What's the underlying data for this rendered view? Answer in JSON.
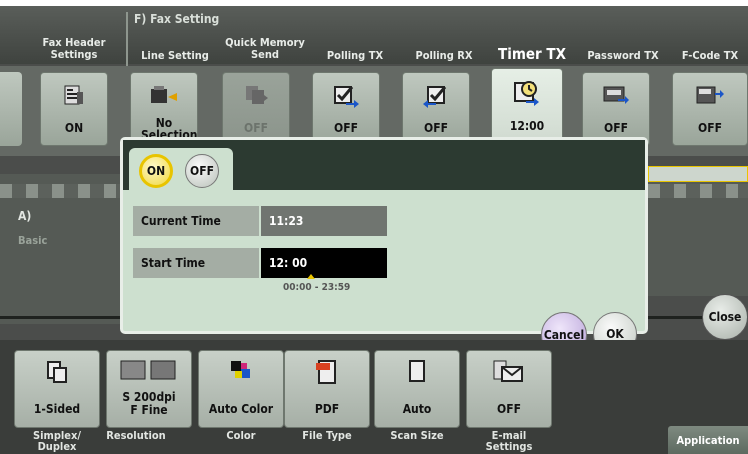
{
  "section_title": "F)  Fax Setting",
  "top_tabs": [
    {
      "label": "Fax Header Settings",
      "value": "ON",
      "icon": "fax-header-icon"
    },
    {
      "label": "Line Setting",
      "value": "No Selection",
      "icon": "line-setting-icon"
    },
    {
      "label": "Quick Memory Send",
      "value": "OFF",
      "icon": "quick-memory-icon"
    },
    {
      "label": "Polling TX",
      "value": "OFF",
      "icon": "polling-tx-icon"
    },
    {
      "label": "Polling RX",
      "value": "OFF",
      "icon": "polling-rx-icon"
    },
    {
      "label": "Timer TX",
      "value": "12:00",
      "icon": "timer-tx-icon"
    },
    {
      "label": "Password TX",
      "value": "OFF",
      "icon": "password-tx-icon"
    },
    {
      "label": "F-Code TX",
      "value": "OFF",
      "icon": "f-code-tx-icon"
    }
  ],
  "left_panel": {
    "a_label": "A)",
    "basic_label": "Basic"
  },
  "dialog": {
    "on_label": "ON",
    "off_label": "OFF",
    "current_time_label": "Current Time",
    "current_time_value": "11:23",
    "start_time_label": "Start Time",
    "start_time_value": "12: 00",
    "range_hint": "00:00 - 23:59",
    "cancel_label": "Cancel",
    "ok_label": "OK"
  },
  "close_label": "Close",
  "bottom_tiles": [
    {
      "value": "1-Sided",
      "label": "Simplex/ Duplex",
      "icon": "simplex-icon"
    },
    {
      "value": "S 200dpi F Fine",
      "label": "Resolution",
      "icon": "resolution-icon"
    },
    {
      "value": "Auto Color",
      "label": "Color",
      "icon": "color-icon"
    },
    {
      "value": "PDF",
      "label": "File Type",
      "icon": "pdf-icon"
    },
    {
      "value": "Auto",
      "label": "Scan Size",
      "icon": "scan-size-icon"
    },
    {
      "value": "OFF",
      "label": "E-mail Settings",
      "icon": "email-icon"
    }
  ],
  "application_label": "Application",
  "colors": {
    "accent_gold": "#e8c400",
    "dialog_bg": "#cde0cf",
    "cancel_purple": "#c9b6e4"
  }
}
